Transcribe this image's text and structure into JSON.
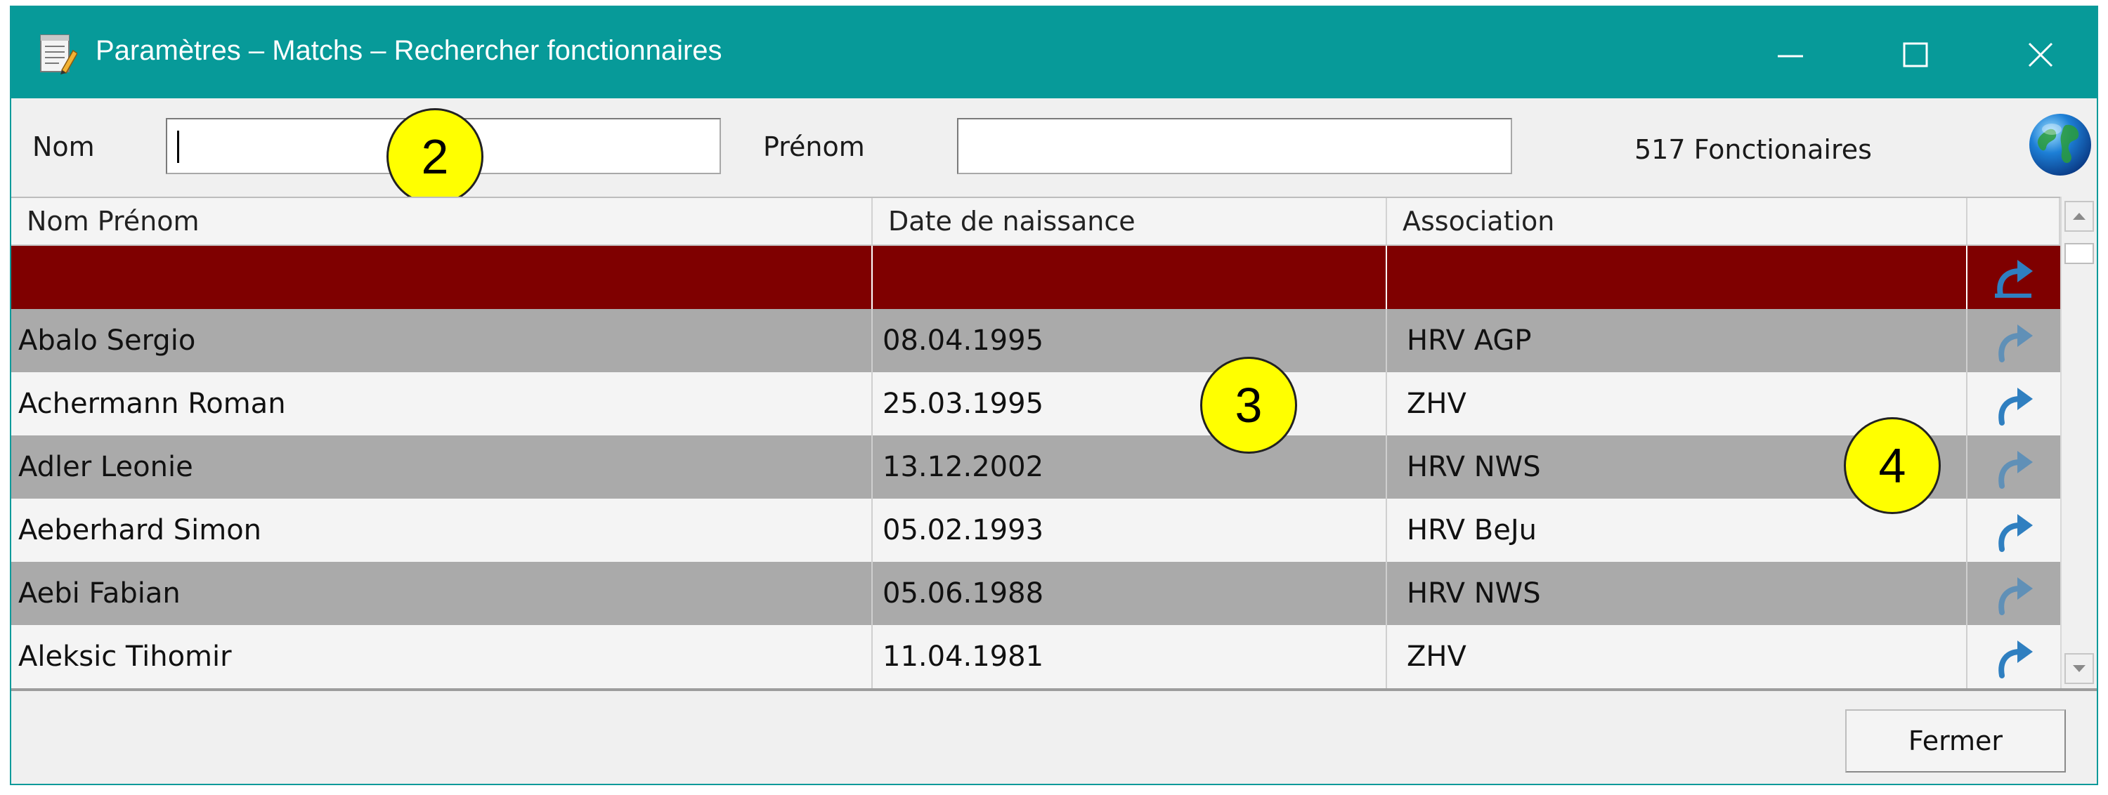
{
  "window": {
    "title": "Paramètres – Matchs – Rechercher fonctionnaires"
  },
  "search": {
    "nom_label": "Nom",
    "nom_value": "",
    "prenom_label": "Prénom",
    "prenom_value": "",
    "count": "517 Fonctionaires"
  },
  "badges": [
    "2",
    "3",
    "4"
  ],
  "table": {
    "columns": [
      "Nom Prénom",
      "Date de naissance",
      "Association",
      ""
    ],
    "rows": [
      {
        "name": "",
        "birth": "",
        "assoc": "",
        "selected": true
      },
      {
        "name": "Abalo Sergio",
        "birth": "08.04.1995",
        "assoc": "HRV AGP"
      },
      {
        "name": "Achermann Roman",
        "birth": "25.03.1995",
        "assoc": "ZHV"
      },
      {
        "name": "Adler Leonie",
        "birth": "13.12.2002",
        "assoc": "HRV NWS"
      },
      {
        "name": "Aeberhard Simon",
        "birth": "05.02.1993",
        "assoc": "HRV BeJu"
      },
      {
        "name": "Aebi Fabian",
        "birth": "05.06.1988",
        "assoc": "HRV NWS"
      },
      {
        "name": "Aleksic Tihomir",
        "birth": "11.04.1981",
        "assoc": "ZHV"
      }
    ]
  },
  "footer": {
    "close_label": "Fermer"
  },
  "icons": {
    "app": "notepad-icon",
    "globe": "globe-icon",
    "row_action": "redo-arrow-icon"
  },
  "colors": {
    "titlebar": "#079a99",
    "selected_row": "#7f0000",
    "gray_row": "#aaaaaa",
    "badge": "#ffff00"
  }
}
